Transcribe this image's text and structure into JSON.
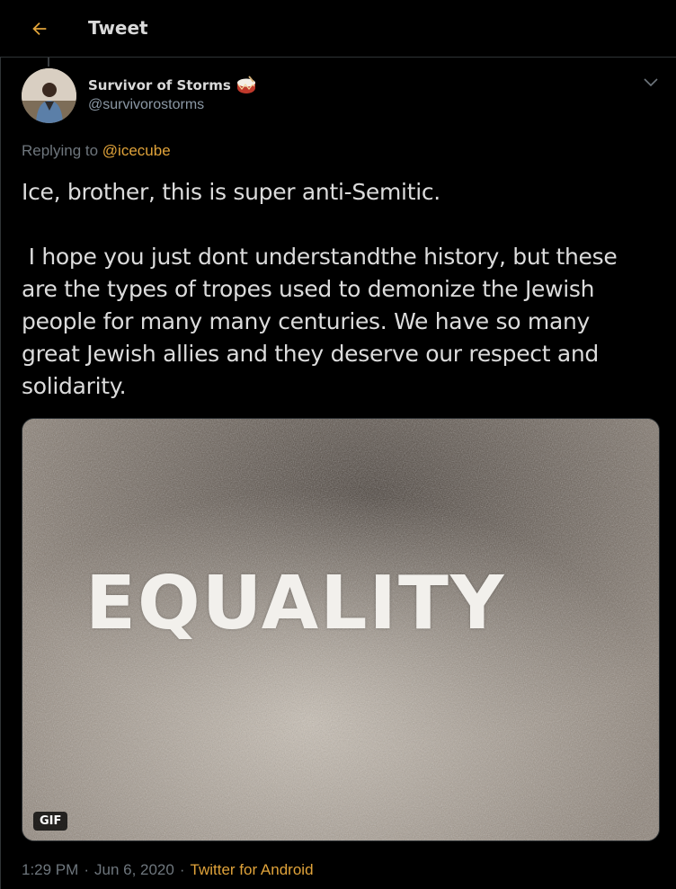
{
  "header": {
    "title": "Tweet",
    "back_icon": "arrow-left-icon",
    "accent_color": "#e0a33a"
  },
  "author": {
    "name": "Survivor of Storms",
    "handle": "@survivorostorms",
    "badge_icon": "drum-emoji-icon"
  },
  "reply": {
    "prefix": "Replying to",
    "mention": "@icecube"
  },
  "tweet": {
    "text": "Ice, brother, this is super anti-Semitic.\n\n I hope you just dont understandthe history, but these are the types of tropes used to demonize the Jewish people for many many centuries. We have so many great Jewish allies and they deserve our respect and solidarity."
  },
  "media": {
    "overlay_text": "EQUALITY",
    "badge": "GIF"
  },
  "meta": {
    "time": "1:29 PM",
    "separator1": "·",
    "date": "Jun 6, 2020",
    "separator2": "·",
    "source": "Twitter for Android"
  },
  "colors": {
    "background": "#000000",
    "text": "#d9d9d9",
    "muted": "#6e767d",
    "link": "#e0a33a"
  }
}
